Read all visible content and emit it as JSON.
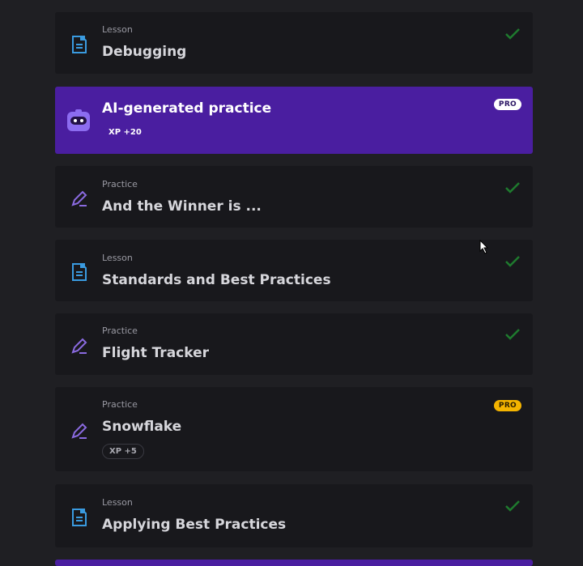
{
  "items": [
    {
      "kind": "Lesson",
      "title": "Debugging",
      "completed": true
    },
    {
      "kind": "",
      "title": "AI-generated practice",
      "badge": "PRO",
      "xp": "XP +20",
      "ai": true
    },
    {
      "kind": "Practice",
      "title": "And the Winner is ...",
      "completed": true
    },
    {
      "kind": "Lesson",
      "title": "Standards and Best Practices",
      "completed": true
    },
    {
      "kind": "Practice",
      "title": "Flight Tracker",
      "completed": true
    },
    {
      "kind": "Practice",
      "title": "Snowflake",
      "badge": "PRO",
      "xp": "XP +5"
    },
    {
      "kind": "Lesson",
      "title": "Applying Best Practices",
      "completed": true
    }
  ],
  "colors": {
    "background": "#1f1f23",
    "card": "#18181c",
    "ai_card": "#4a1ea0",
    "lesson_icon": "#3a9be0",
    "practice_icon": "#8a6ae0",
    "check": "#1f7a2e",
    "pro_yellow": "#f4b400"
  },
  "icons": {
    "lesson": "lesson-document-icon",
    "practice": "practice-pencil-icon",
    "ai": "ai-robot-icon",
    "done": "checkmark-icon"
  }
}
